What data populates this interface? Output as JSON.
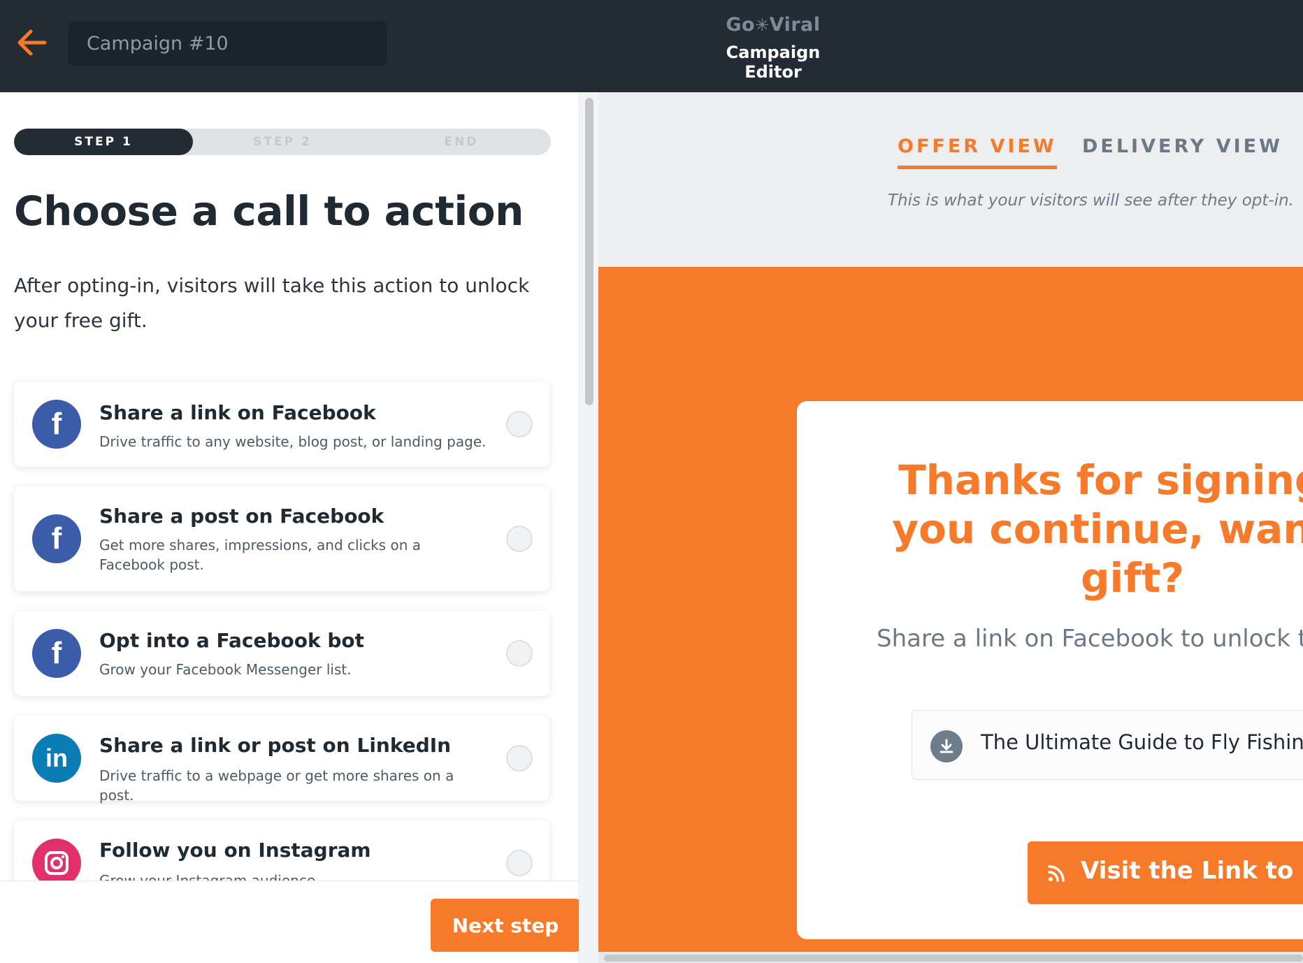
{
  "header": {
    "campaign_name": "Campaign #10",
    "brand_logo": "Go✳Viral",
    "brand_logo_left": "Go",
    "brand_logo_right": "Viral",
    "subtitle": "Campaign Editor",
    "back_icon": "arrow-left-icon"
  },
  "colors": {
    "accent": "#f77a2a",
    "header_bg": "#232c35",
    "facebook": "#3b5ca8",
    "linkedin": "#0a7cb6",
    "instagram": "#e1306c"
  },
  "stepper": {
    "steps": [
      {
        "label": "STEP 1",
        "active": true
      },
      {
        "label": "STEP 2",
        "active": false
      },
      {
        "label": "END",
        "active": false
      }
    ]
  },
  "main": {
    "title": "Choose a call to action",
    "description": "After opting-in, visitors will take this action to unlock your free gift.",
    "options": [
      {
        "icon": "facebook-icon",
        "glyph": "f",
        "title": "Share a link on Facebook",
        "description": "Drive traffic to any website, blog post, or landing page.",
        "selected": false
      },
      {
        "icon": "facebook-icon",
        "glyph": "f",
        "title": "Share a post on Facebook",
        "description": "Get more shares, impressions, and clicks on a Facebook post.",
        "selected": false
      },
      {
        "icon": "facebook-icon",
        "glyph": "f",
        "title": "Opt into a Facebook bot",
        "description": "Grow your Facebook Messenger list.",
        "selected": false
      },
      {
        "icon": "linkedin-icon",
        "glyph": "in",
        "title": "Share a link or post on LinkedIn",
        "description": "Drive traffic to a webpage or get more shares on a post.",
        "selected": false
      },
      {
        "icon": "instagram-icon",
        "glyph": "",
        "title": "Follow you on Instagram",
        "description": "Grow your Instagram audience.",
        "selected": false
      }
    ],
    "next_button": "Next step"
  },
  "preview": {
    "tabs": [
      {
        "label": "OFFER VIEW",
        "active": true
      },
      {
        "label": "DELIVERY VIEW",
        "active": false
      }
    ],
    "hint": "This is what your visitors will see after they opt-in.",
    "headline": "Thanks for signing u\nyou continue, want a\ngift?",
    "subtext": "Share a link on Facebook to unlock th",
    "gift_title": "The Ultimate Guide to Fly Fishing",
    "gift_icon": "download-icon",
    "cta_label": "Visit the Link to Un",
    "cta_icon": "rss-icon"
  }
}
